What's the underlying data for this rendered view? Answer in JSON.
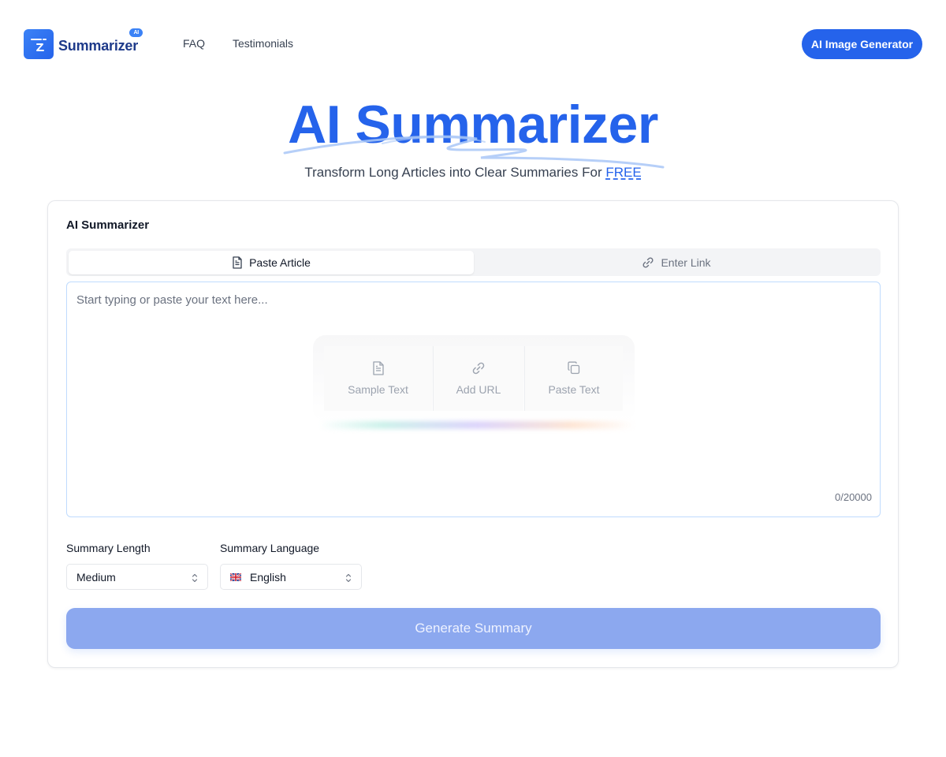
{
  "brand": {
    "name": "Summarizer",
    "badge": "AI"
  },
  "nav": {
    "faq": "FAQ",
    "testimonials": "Testimonials",
    "cta": "AI Image Generator"
  },
  "hero": {
    "title": "AI Summarizer",
    "subtitle": "Transform Long Articles into Clear Summaries For ",
    "subtitle_highlight": "FREE"
  },
  "card": {
    "title": "AI Summarizer",
    "tabs": [
      {
        "label": "Paste Article",
        "icon": "document-icon",
        "active": true
      },
      {
        "label": "Enter Link",
        "icon": "link-icon",
        "active": false
      }
    ],
    "editor": {
      "placeholder": "Start typing or paste your text here...",
      "value": "",
      "counter": "0/20000"
    },
    "quick_actions": [
      {
        "label": "Sample Text",
        "icon": "document-icon"
      },
      {
        "label": "Add URL",
        "icon": "link-icon"
      },
      {
        "label": "Paste Text",
        "icon": "copy-icon"
      }
    ],
    "summary_length": {
      "label": "Summary Length",
      "value": "Medium"
    },
    "summary_language": {
      "label": "Summary Language",
      "value": "English",
      "flag": "uk-flag-icon"
    },
    "generate_label": "Generate Summary"
  },
  "colors": {
    "primary": "#2563eb",
    "generate_disabled": "#8ca8ef",
    "logo_text": "#1e3a8a"
  }
}
